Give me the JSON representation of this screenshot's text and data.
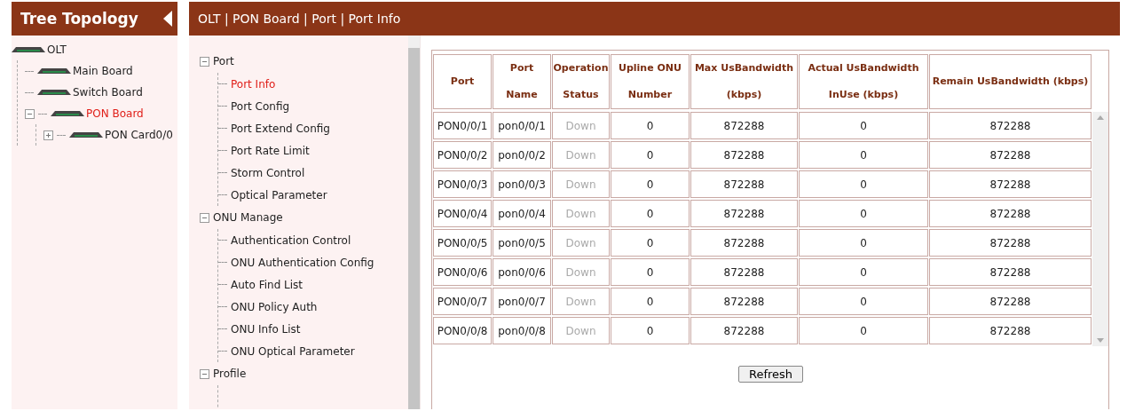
{
  "sidebar": {
    "title": "Tree Topology",
    "tree": [
      {
        "label": "OLT",
        "selected": false,
        "children": [
          {
            "label": "Main Board",
            "selected": false
          },
          {
            "label": "Switch Board",
            "selected": false
          },
          {
            "label": "PON Board",
            "selected": true,
            "expanded": true,
            "children": [
              {
                "label": "PON Card0/0",
                "selected": false,
                "expanded": false
              }
            ]
          }
        ]
      }
    ]
  },
  "breadcrumb": "OLT | PON Board | Port | Port Info",
  "menu": [
    {
      "label": "Port",
      "expanded": true,
      "items": [
        {
          "label": "Port Info",
          "selected": true
        },
        {
          "label": "Port Config",
          "selected": false
        },
        {
          "label": "Port Extend Config",
          "selected": false
        },
        {
          "label": "Port Rate Limit",
          "selected": false
        },
        {
          "label": "Storm Control",
          "selected": false
        },
        {
          "label": "Optical Parameter",
          "selected": false
        }
      ]
    },
    {
      "label": "ONU Manage",
      "expanded": true,
      "items": [
        {
          "label": "Authentication Control",
          "selected": false
        },
        {
          "label": "ONU Authentication Config",
          "selected": false
        },
        {
          "label": "Auto Find List",
          "selected": false
        },
        {
          "label": "ONU Policy Auth",
          "selected": false
        },
        {
          "label": "ONU Info List",
          "selected": false
        },
        {
          "label": "ONU Optical Parameter",
          "selected": false
        }
      ]
    },
    {
      "label": "Profile",
      "expanded": true
    }
  ],
  "table": {
    "columns": [
      "Port",
      "Port\nName",
      "Operation\nStatus",
      "Upline ONU\nNumber",
      "Max UsBandwidth\n(kbps)",
      "Actual UsBandwidth\nInUse (kbps)",
      "Remain UsBandwidth (kbps)"
    ],
    "rows": [
      [
        "PON0/0/1",
        "pon0/0/1",
        "Down",
        "0",
        "872288",
        "0",
        "872288"
      ],
      [
        "PON0/0/2",
        "pon0/0/2",
        "Down",
        "0",
        "872288",
        "0",
        "872288"
      ],
      [
        "PON0/0/3",
        "pon0/0/3",
        "Down",
        "0",
        "872288",
        "0",
        "872288"
      ],
      [
        "PON0/0/4",
        "pon0/0/4",
        "Down",
        "0",
        "872288",
        "0",
        "872288"
      ],
      [
        "PON0/0/5",
        "pon0/0/5",
        "Down",
        "0",
        "872288",
        "0",
        "872288"
      ],
      [
        "PON0/0/6",
        "pon0/0/6",
        "Down",
        "0",
        "872288",
        "0",
        "872288"
      ],
      [
        "PON0/0/7",
        "pon0/0/7",
        "Down",
        "0",
        "872288",
        "0",
        "872288"
      ],
      [
        "PON0/0/8",
        "pon0/0/8",
        "Down",
        "0",
        "872288",
        "0",
        "872288"
      ]
    ]
  },
  "refresh_button": "Refresh"
}
